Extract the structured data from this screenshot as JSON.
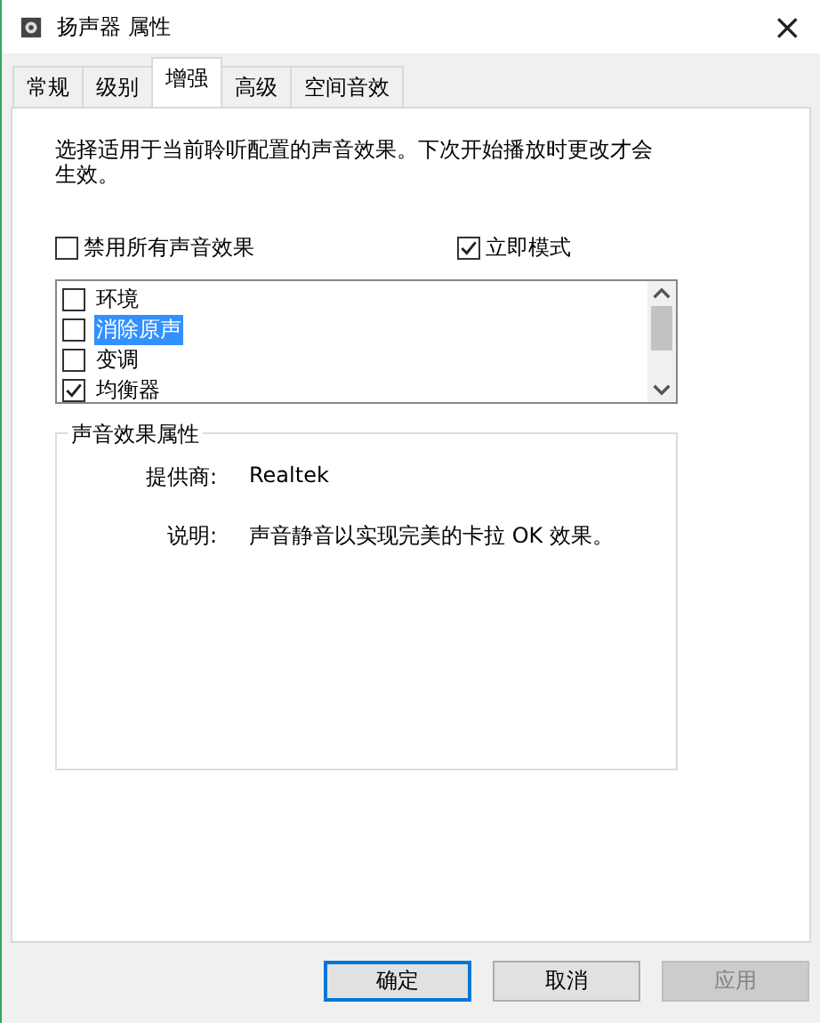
{
  "window": {
    "title": "扬声器 属性",
    "close": "×"
  },
  "tabs": [
    {
      "label": "常规",
      "selected": false
    },
    {
      "label": "级别",
      "selected": false
    },
    {
      "label": "增强",
      "selected": true
    },
    {
      "label": "高级",
      "selected": false
    },
    {
      "label": "空间音效",
      "selected": false
    }
  ],
  "description": "选择适用于当前聆听配置的声音效果。下次开始播放时更改才会生效。",
  "options": [
    {
      "label": "禁用所有声音效果",
      "checked": false
    },
    {
      "label": "立即模式",
      "checked": true
    }
  ],
  "effects": [
    {
      "label": "环境",
      "checked": false,
      "selected": false
    },
    {
      "label": "消除原声",
      "checked": false,
      "selected": true
    },
    {
      "label": "变调",
      "checked": false,
      "selected": false
    },
    {
      "label": "均衡器",
      "checked": true,
      "selected": false
    }
  ],
  "properties": {
    "title": "声音效果属性",
    "rows": [
      {
        "label": "提供商:",
        "value": "Realtek"
      },
      {
        "label": "说明:",
        "value": "声音静音以实现完美的卡拉 OK 效果。"
      }
    ]
  },
  "buttons": [
    {
      "label": "确定",
      "kind": "default"
    },
    {
      "label": "取消",
      "kind": "normal"
    },
    {
      "label": "应用",
      "kind": "disabled"
    }
  ]
}
